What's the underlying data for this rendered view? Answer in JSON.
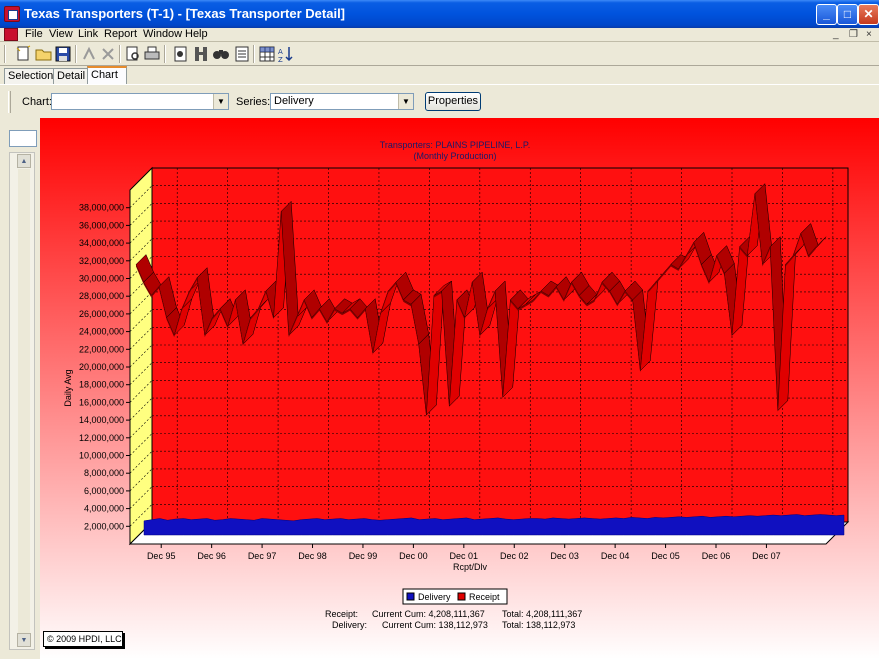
{
  "window": {
    "title": "Texas Transporters (T-1) - [Texas Transporter Detail]",
    "minimize": "_",
    "maximize": "□",
    "close": "✕"
  },
  "menu": {
    "items": [
      "File",
      "View",
      "Link",
      "Report",
      "Window",
      "Help"
    ],
    "mdi_minimize": "_",
    "mdi_restore": "❐",
    "mdi_close": "×"
  },
  "toolbar": {
    "icons": [
      "new-icon",
      "open-icon",
      "save-icon",
      "merge-icon",
      "delete-icon",
      "print-preview-icon",
      "print-icon",
      "export-icon",
      "pipeline-icon",
      "search-icon",
      "report-icon",
      "grid-icon",
      "sort-icon"
    ]
  },
  "tabs": [
    "Selection",
    "Detail",
    "Chart"
  ],
  "active_tab": "Chart",
  "options": {
    "chart_label": "Chart:",
    "chart_value": "",
    "series_label": "Series:",
    "series_value": "Delivery",
    "properties_button": "Properties"
  },
  "colors": {
    "receipt": "#e00000",
    "delivery": "#1010c0",
    "background_top": "#ff0000",
    "background_bottom": "#ffffff",
    "back_wall": "#ff1010",
    "side_wall": "#ffff80"
  },
  "chart_data": {
    "type": "area",
    "title": "Transporters: PLAINS PIPELINE, L.P.",
    "subtitle": "(Monthly Production)",
    "xlabel": "Rcpt/Dlv",
    "ylabel": "Daily Avg",
    "ylim": [
      0,
      40000000
    ],
    "yticks": [
      2000000,
      4000000,
      6000000,
      8000000,
      10000000,
      12000000,
      14000000,
      16000000,
      18000000,
      20000000,
      22000000,
      24000000,
      26000000,
      28000000,
      30000000,
      32000000,
      34000000,
      36000000,
      38000000
    ],
    "ytick_labels": [
      "2,000,000",
      "4,000,000",
      "6,000,000",
      "8,000,000",
      "10,000,000",
      "12,000,000",
      "14,000,000",
      "16,000,000",
      "18,000,000",
      "20,000,000",
      "22,000,000",
      "24,000,000",
      "26,000,000",
      "28,000,000",
      "30,000,000",
      "32,000,000",
      "34,000,000",
      "36,000,000",
      "38,000,000"
    ],
    "xtick_labels": [
      "Dec 95",
      "Dec 96",
      "Dec 97",
      "Dec 98",
      "Dec 99",
      "Dec 00",
      "Dec 01",
      "Dec 02",
      "Dec 03",
      "Dec 04",
      "Dec 05",
      "Dec 06",
      "Dec 07"
    ],
    "grid": true,
    "legend_position": "bottom",
    "series": [
      {
        "name": "Receipt",
        "color": "#e00000",
        "values": [
          30000000,
          28000000,
          26500000,
          27500000,
          24000000,
          22000000,
          25000000,
          27000000,
          28500000,
          22000000,
          24000000,
          25000000,
          23000000,
          26000000,
          21000000,
          24000000,
          25000000,
          27000000,
          24000000,
          36000000,
          22000000,
          24000000,
          26000000,
          24000000,
          25000000,
          23500000,
          25000000,
          24500000,
          25000000,
          24000000,
          25000000,
          20000000,
          24500000,
          27000000,
          28000000,
          26000000,
          25500000,
          21000000,
          13000000,
          26500000,
          27000000,
          14000000,
          26000000,
          24000000,
          28000000,
          22000000,
          25000000,
          27000000,
          15000000,
          26000000,
          25000000,
          25500000,
          26000000,
          27000000,
          26500000,
          27500000,
          26000000,
          28000000,
          26500000,
          25500000,
          26000000,
          28000000,
          27000000,
          25500000,
          27000000,
          26000000,
          18000000,
          27000000,
          28000000,
          29000000,
          30000000,
          29500000,
          31000000,
          32500000,
          30000000,
          28000000,
          31000000,
          29000000,
          22000000,
          32000000,
          31000000,
          38000000,
          30000000,
          32000000,
          13500000,
          30000000,
          31000000,
          33500000,
          31000000,
          32000000
        ]
      },
      {
        "name": "Delivery",
        "color": "#1010c0",
        "values": [
          800000,
          900000,
          1000000,
          850000,
          950000,
          1000000,
          900000,
          950000,
          1000000,
          850000,
          900000,
          1000000,
          950000,
          900000,
          850000,
          1000000,
          950000,
          900000,
          850000,
          800000,
          900000,
          950000,
          1000000,
          900000,
          950000,
          1000000,
          900000,
          950000,
          1000000,
          900000,
          850000,
          900000,
          950000,
          1000000,
          1050000,
          900000,
          950000,
          1000000,
          900000,
          950000,
          1000000,
          1050000,
          900000,
          950000,
          1000000,
          1050000,
          950000,
          900000,
          950000,
          1000000,
          1000000,
          950000,
          1050000,
          1000000,
          950000,
          1000000,
          1050000,
          1000000,
          950000,
          1000000,
          1050000,
          1000000,
          1100000,
          1050000,
          1000000,
          1100000,
          1050000,
          1100000,
          1150000,
          1100000,
          1150000,
          1200000,
          1100000,
          1150000,
          1200000,
          1150000,
          1200000,
          1250000,
          1200000,
          1250000,
          1300000,
          1250000,
          1300000,
          1350000,
          1250000,
          1300000,
          1350000,
          1300000,
          1250000,
          1300000
        ]
      }
    ]
  },
  "legend": {
    "delivery": "Delivery",
    "receipt": "Receipt"
  },
  "stats": {
    "receipt_label": "Receipt:",
    "receipt_current": "Current Cum: 4,208,111,367",
    "receipt_total": "Total: 4,208,111,367",
    "delivery_label": "Delivery:",
    "delivery_current": "Current Cum: 138,112,973",
    "delivery_total": "Total: 138,112,973"
  },
  "copyright": "© 2009 HPDI, LLC"
}
